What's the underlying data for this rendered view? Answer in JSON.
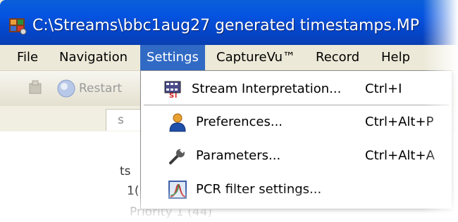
{
  "window": {
    "title": "C:\\Streams\\bbc1aug27 generated timestamps.MP"
  },
  "menubar": {
    "items": [
      {
        "label": "File"
      },
      {
        "label": "Navigation"
      },
      {
        "label": "Settings"
      },
      {
        "label": "CaptureVu™"
      },
      {
        "label": "Record"
      },
      {
        "label": "Help"
      }
    ],
    "active": "Settings"
  },
  "toolbar": {
    "restart_label": "Restart"
  },
  "background": {
    "tab_fragment": "s",
    "text_fragment_1": "ts",
    "text_fragment_2": "1(",
    "text_fragment_3": "Priority 1 (44)"
  },
  "settings_menu": {
    "items": [
      {
        "label": "Stream Interpretation...",
        "shortcut": "Ctrl+I",
        "icon": "stream-interpretation-icon"
      },
      {
        "label": "Preferences...",
        "shortcut": "Ctrl+Alt+P",
        "icon": "user-icon"
      },
      {
        "label": "Parameters...",
        "shortcut": "Ctrl+Alt+A",
        "icon": "wrench-icon"
      },
      {
        "label": "PCR filter settings...",
        "shortcut": "",
        "icon": "pcr-filter-icon"
      }
    ]
  },
  "colors": {
    "titlebar": "#0553e0",
    "menu_highlight": "#316ac5",
    "window_bg": "#ece9d8"
  }
}
